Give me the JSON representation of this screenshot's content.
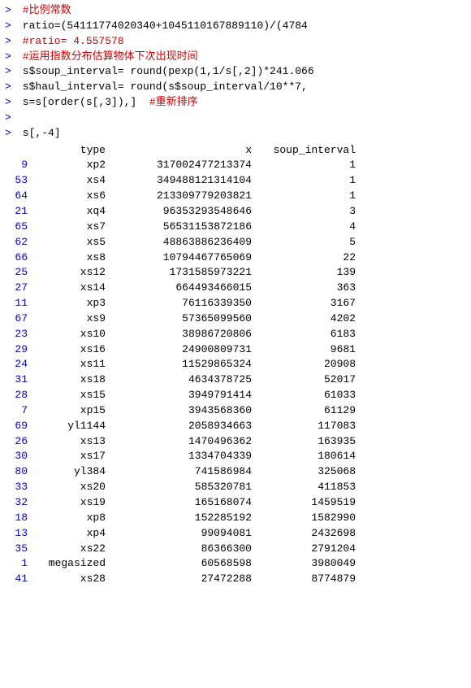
{
  "console": {
    "lines": [
      {
        "type": "comment",
        "prompt": ">",
        "text": " #比例常数"
      },
      {
        "type": "code",
        "prompt": ">",
        "text": " ratio=(54111774020340+1045110167889110)/(4784"
      },
      {
        "type": "comment",
        "prompt": ">",
        "text": " #ratio= 4.557578"
      },
      {
        "type": "comment",
        "prompt": ">",
        "text": " #运用指数分布估算物体下次出现时间"
      },
      {
        "type": "code",
        "prompt": ">",
        "text": " s$soup_interval= round(pexp(1,1/s[,2])*241.066"
      },
      {
        "type": "code",
        "prompt": ">",
        "text": " s$haul_interval= round(s$soup_interval/10**7,"
      },
      {
        "type": "code",
        "prompt": ">",
        "text": " s=s[order(s[,3]),]  #重新排序"
      },
      {
        "type": "empty",
        "prompt": ">",
        "text": ""
      },
      {
        "type": "code",
        "prompt": ">",
        "text": " s[,-4]"
      }
    ],
    "table": {
      "headers": [
        "",
        "type",
        "x",
        "soup_interval"
      ],
      "rows": [
        {
          "rownum": "9",
          "type": "xp2",
          "x": "317002477213374",
          "soup": "1"
        },
        {
          "rownum": "53",
          "type": "xs4",
          "x": "349488121314104",
          "soup": "1"
        },
        {
          "rownum": "64",
          "type": "xs6",
          "x": "213309779203821",
          "soup": "1"
        },
        {
          "rownum": "21",
          "type": "xq4",
          "x": "96353293548646",
          "soup": "3"
        },
        {
          "rownum": "65",
          "type": "xs7",
          "x": "56531153872186",
          "soup": "4"
        },
        {
          "rownum": "62",
          "type": "xs5",
          "x": "48863886236409",
          "soup": "5"
        },
        {
          "rownum": "66",
          "type": "xs8",
          "x": "10794467765069",
          "soup": "22"
        },
        {
          "rownum": "25",
          "type": "xs12",
          "x": "1731585973221",
          "soup": "139"
        },
        {
          "rownum": "27",
          "type": "xs14",
          "x": "664493466015",
          "soup": "363"
        },
        {
          "rownum": "11",
          "type": "xp3",
          "x": "76116339350",
          "soup": "3167"
        },
        {
          "rownum": "67",
          "type": "xs9",
          "x": "57365099560",
          "soup": "4202"
        },
        {
          "rownum": "23",
          "type": "xs10",
          "x": "38986720806",
          "soup": "6183"
        },
        {
          "rownum": "29",
          "type": "xs16",
          "x": "24900809731",
          "soup": "9681"
        },
        {
          "rownum": "24",
          "type": "xs11",
          "x": "11529865324",
          "soup": "20908"
        },
        {
          "rownum": "31",
          "type": "xs18",
          "x": "4634378725",
          "soup": "52017"
        },
        {
          "rownum": "28",
          "type": "xs15",
          "x": "3949791414",
          "soup": "61033"
        },
        {
          "rownum": "7",
          "type": "xp15",
          "x": "3943568360",
          "soup": "61129"
        },
        {
          "rownum": "69",
          "type": "yl1144",
          "x": "2058934663",
          "soup": "117083"
        },
        {
          "rownum": "26",
          "type": "xs13",
          "x": "1470496362",
          "soup": "163935"
        },
        {
          "rownum": "30",
          "type": "xs17",
          "x": "1334704339",
          "soup": "180614"
        },
        {
          "rownum": "80",
          "type": "yl384",
          "x": "741586984",
          "soup": "325068"
        },
        {
          "rownum": "33",
          "type": "xs20",
          "x": "585320781",
          "soup": "411853"
        },
        {
          "rownum": "32",
          "type": "xs19",
          "x": "165168074",
          "soup": "1459519"
        },
        {
          "rownum": "18",
          "type": "xp8",
          "x": "152285192",
          "soup": "1582990"
        },
        {
          "rownum": "13",
          "type": "xp4",
          "x": "99094081",
          "soup": "2432698"
        },
        {
          "rownum": "35",
          "type": "xs22",
          "x": "86366300",
          "soup": "2791204"
        },
        {
          "rownum": "1",
          "type": "megasized",
          "x": "60568598",
          "soup": "3980049"
        },
        {
          "rownum": "41",
          "type": "xs28",
          "x": "27472288",
          "soup": "8774879"
        }
      ]
    }
  }
}
